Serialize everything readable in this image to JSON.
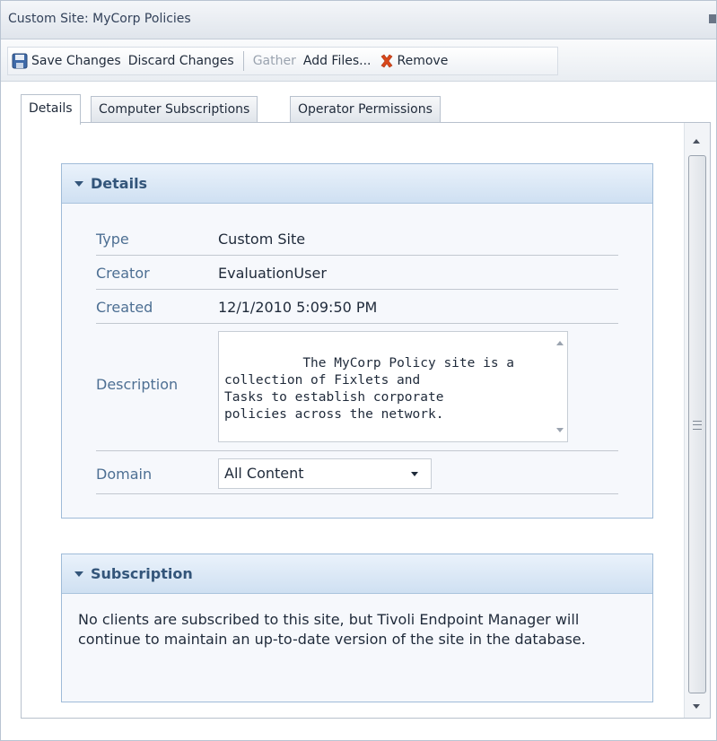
{
  "window": {
    "title": "Custom Site: MyCorp Policies"
  },
  "toolbar": {
    "save_label": "Save Changes",
    "discard_label": "Discard Changes",
    "gather_label": "Gather",
    "add_files_label": "Add Files...",
    "remove_label": "Remove"
  },
  "tabs": [
    {
      "label": "Details",
      "active": true
    },
    {
      "label": "Computer Subscriptions",
      "active": false
    },
    {
      "label": "Operator Permissions",
      "active": false
    }
  ],
  "details": {
    "heading": "Details",
    "type_label": "Type",
    "type_value": "Custom Site",
    "creator_label": "Creator",
    "creator_value": "EvaluationUser",
    "created_label": "Created",
    "created_value": "12/1/2010 5:09:50 PM",
    "description_label": "Description",
    "description_value": "The MyCorp Policy site is a\ncollection of Fixlets and\nTasks to establish corporate\npolicies across the network.",
    "domain_label": "Domain",
    "domain_value": "All Content"
  },
  "subscription": {
    "heading": "Subscription",
    "text": "No clients are subscribed to this site, but Tivoli Endpoint Manager will continue to maintain an up-to-date version of the site in the database."
  },
  "colors": {
    "panel_header": "#cfe0f2",
    "label_blue": "#4d6f93",
    "remove_red": "#d9481c"
  }
}
